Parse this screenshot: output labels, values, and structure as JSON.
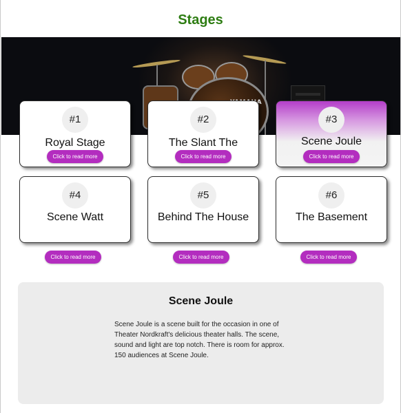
{
  "page": {
    "title": "Stages"
  },
  "hero": {
    "brand_text": "YAMAHA"
  },
  "stages": [
    {
      "number": "#1",
      "name": "Royal Stage",
      "button_label": "Click to read more"
    },
    {
      "number": "#2",
      "name": "The Slant The",
      "button_label": "Click to read more"
    },
    {
      "number": "#3",
      "name": "Scene Joule",
      "button_label": "Click to read more"
    },
    {
      "number": "#4",
      "name": "Scene Watt",
      "button_label": "Click to read more"
    },
    {
      "number": "#5",
      "name": "Behind The House",
      "button_label": "Click to read more"
    },
    {
      "number": "#6",
      "name": "The Basement",
      "button_label": "Click to read more"
    }
  ],
  "selected_stage": {
    "title": "Scene Joule",
    "description": "Scene Joule is a scene built for the occasion in one of Theater Nordkraft's delicious theater halls. The scene, sound and light are top notch. There is room for approx. 150 audiences at Scene Joule."
  },
  "colors": {
    "title_green": "#2e7d13",
    "button_purple": "#b32dbf",
    "active_gradient_top": "#b43ec9",
    "panel_gray": "#ececec"
  }
}
